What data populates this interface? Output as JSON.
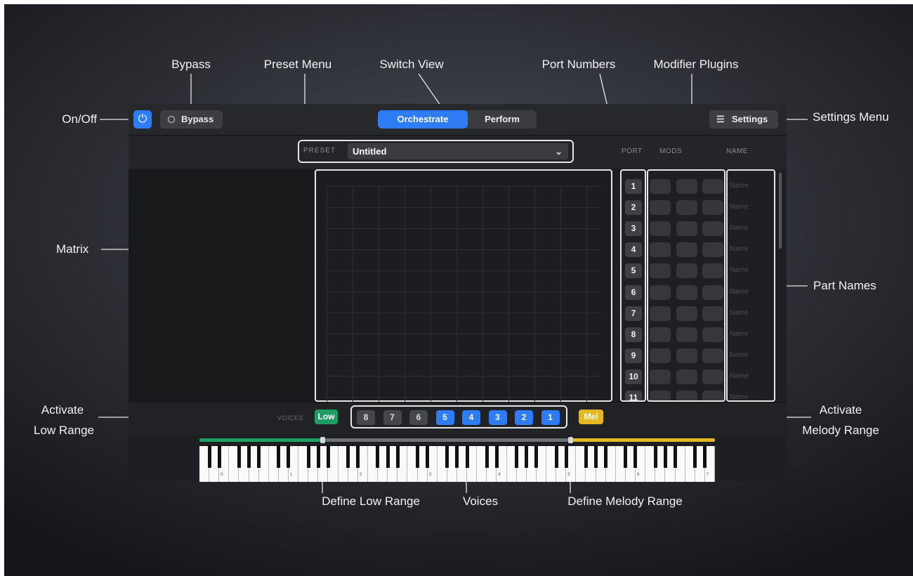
{
  "callouts": {
    "bypass": "Bypass",
    "preset_menu": "Preset Menu",
    "switch_view": "Switch View",
    "port_numbers": "Port Numbers",
    "modifier_plugins": "Modifier Plugins",
    "on_off": "On/Off",
    "settings_menu": "Settings Menu",
    "matrix": "Matrix",
    "part_names": "Part Names",
    "activate_low_line1": "Activate",
    "activate_low_line2": "Low Range",
    "activate_melody_line1": "Activate",
    "activate_melody_line2": "Melody Range",
    "define_low_range": "Define Low Range",
    "voices": "Voices",
    "define_melody_range": "Define Melody Range"
  },
  "toolbar": {
    "power_icon": "power-icon",
    "bypass_label": "Bypass",
    "views": [
      {
        "label": "Orchestrate",
        "active": true
      },
      {
        "label": "Perform",
        "active": false
      }
    ],
    "settings_label": "Settings",
    "settings_icon": "sliders-icon"
  },
  "preset": {
    "label": "PRESET",
    "value": "Untitled"
  },
  "columns": {
    "port": "PORT",
    "mods": "MODS",
    "name": "NAME"
  },
  "parts": {
    "ports": [
      "1",
      "2",
      "3",
      "4",
      "5",
      "6",
      "7",
      "8",
      "9",
      "10",
      "11"
    ],
    "name_placeholder": "Name"
  },
  "voices_row": {
    "label": "VOICES",
    "low_button": "Low",
    "voices": [
      {
        "label": "8",
        "active": false
      },
      {
        "label": "7",
        "active": false
      },
      {
        "label": "6",
        "active": false
      },
      {
        "label": "5",
        "active": true
      },
      {
        "label": "4",
        "active": true
      },
      {
        "label": "3",
        "active": true
      },
      {
        "label": "2",
        "active": true
      },
      {
        "label": "1",
        "active": true
      }
    ],
    "melody_button": "Mel"
  },
  "keyboard": {
    "octave_labels": [
      "0",
      "1",
      "2",
      "3",
      "4",
      "5",
      "6",
      "7"
    ],
    "low_range_color": "#1f9e63",
    "melody_range_color": "#e3b824"
  },
  "colors": {
    "accent": "#2e7cf6"
  }
}
